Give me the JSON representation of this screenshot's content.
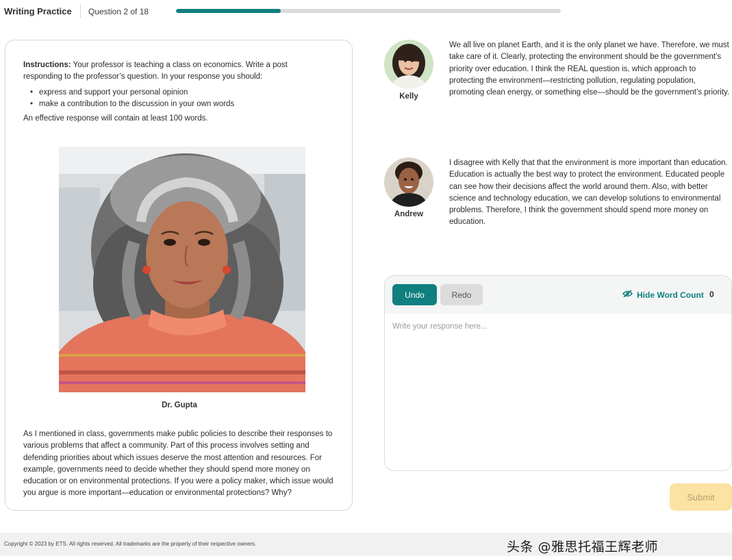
{
  "header": {
    "app_title": "Writing Practice",
    "question_counter": "Question 2 of 18",
    "progress_fraction": 0.273,
    "accent_color": "#0f7f7f"
  },
  "prompt": {
    "instructions_label": "Instructions:",
    "instructions_text": " Your professor is teaching a class on economics. Write a post responding to the professor’s question. In your response you should:",
    "bullets": [
      "express and support your personal opinion",
      "make a contribution to the discussion in your own words"
    ],
    "effective_note": "An effective response will contain at least 100 words.",
    "professor_name": "Dr. Gupta",
    "professor_text": "As I mentioned in class, governments make public policies to describe their responses to various problems that affect a community. Part of this process involves setting and defending priorities about which issues deserve the most attention and resources. For example, governments need to decide whether they should spend more money on education or on environmental protections. If you were a policy maker, which issue would you argue is more important—education or environmental protections? Why?"
  },
  "posts": [
    {
      "name": "Kelly",
      "text": "We all live on planet Earth, and it is the only planet we have. Therefore, we must take care of it. Clearly, protecting the environment should be the government’s priority over education. I think the REAL question is, which approach to protecting the environment—restricting pollution, regulating population, promoting clean energy, or something else—should be the government’s priority."
    },
    {
      "name": "Andrew",
      "text": "I disagree with Kelly that that the environment is more important than education. Education is actually the best way to protect the environment. Educated people can see how their decisions affect the world around them. Also, with better science and technology education, we can develop solutions to environmental problems. Therefore, I think the government should spend more money on education."
    }
  ],
  "editor": {
    "undo_label": "Undo",
    "redo_label": "Redo",
    "hide_word_count_label": "Hide Word Count",
    "word_count": "0",
    "placeholder": "Write your response here...",
    "value": ""
  },
  "submit_label": "Submit",
  "footer": {
    "copyright": "Copyright © 2023 by ETS. All rights reserved. All trademarks are the property of their respective owners.",
    "watermark": "头条 @雅思托福王辉老师"
  },
  "icons": {
    "hide_word_count": "eye-slash-icon"
  }
}
